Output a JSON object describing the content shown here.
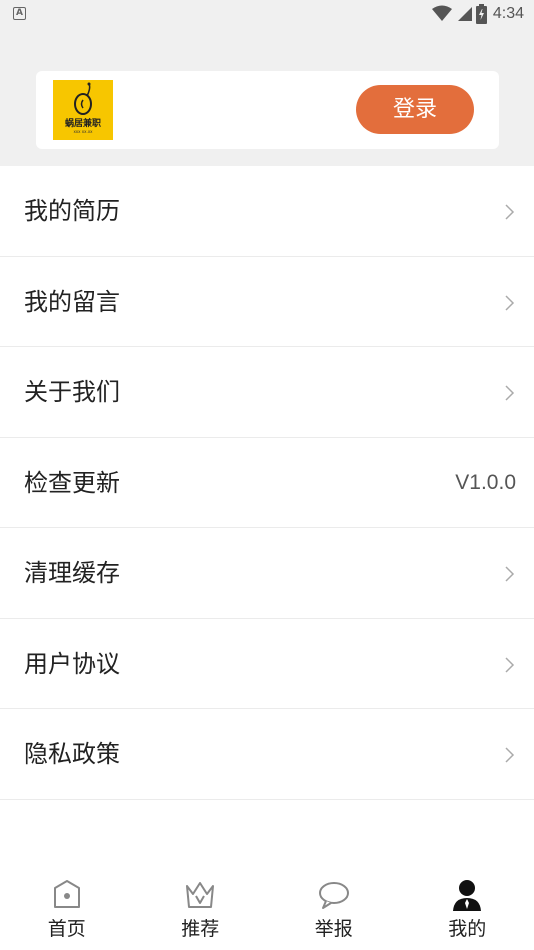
{
  "status_bar": {
    "notification_badge": "A",
    "time": "4:34"
  },
  "header": {
    "logo": {
      "text": "蜗居兼职",
      "subtext": "xxx  xx.xx"
    },
    "login_label": "登录"
  },
  "menu": {
    "items": [
      {
        "label": "我的简历",
        "value": ""
      },
      {
        "label": "我的留言",
        "value": ""
      },
      {
        "label": "关于我们",
        "value": ""
      },
      {
        "label": "检查更新",
        "value": "V1.0.0"
      },
      {
        "label": "清理缓存",
        "value": ""
      },
      {
        "label": "用户协议",
        "value": ""
      },
      {
        "label": "隐私政策",
        "value": ""
      }
    ]
  },
  "bottom_nav": {
    "items": [
      {
        "label": "首页",
        "icon": "home-icon"
      },
      {
        "label": "推荐",
        "icon": "crown-icon"
      },
      {
        "label": "举报",
        "icon": "chat-bubble-icon"
      },
      {
        "label": "我的",
        "icon": "user-icon",
        "active": true
      }
    ]
  },
  "colors": {
    "accent": "#e36e3c",
    "logo_bg": "#f7c600",
    "header_bg": "#f0f0f0"
  }
}
